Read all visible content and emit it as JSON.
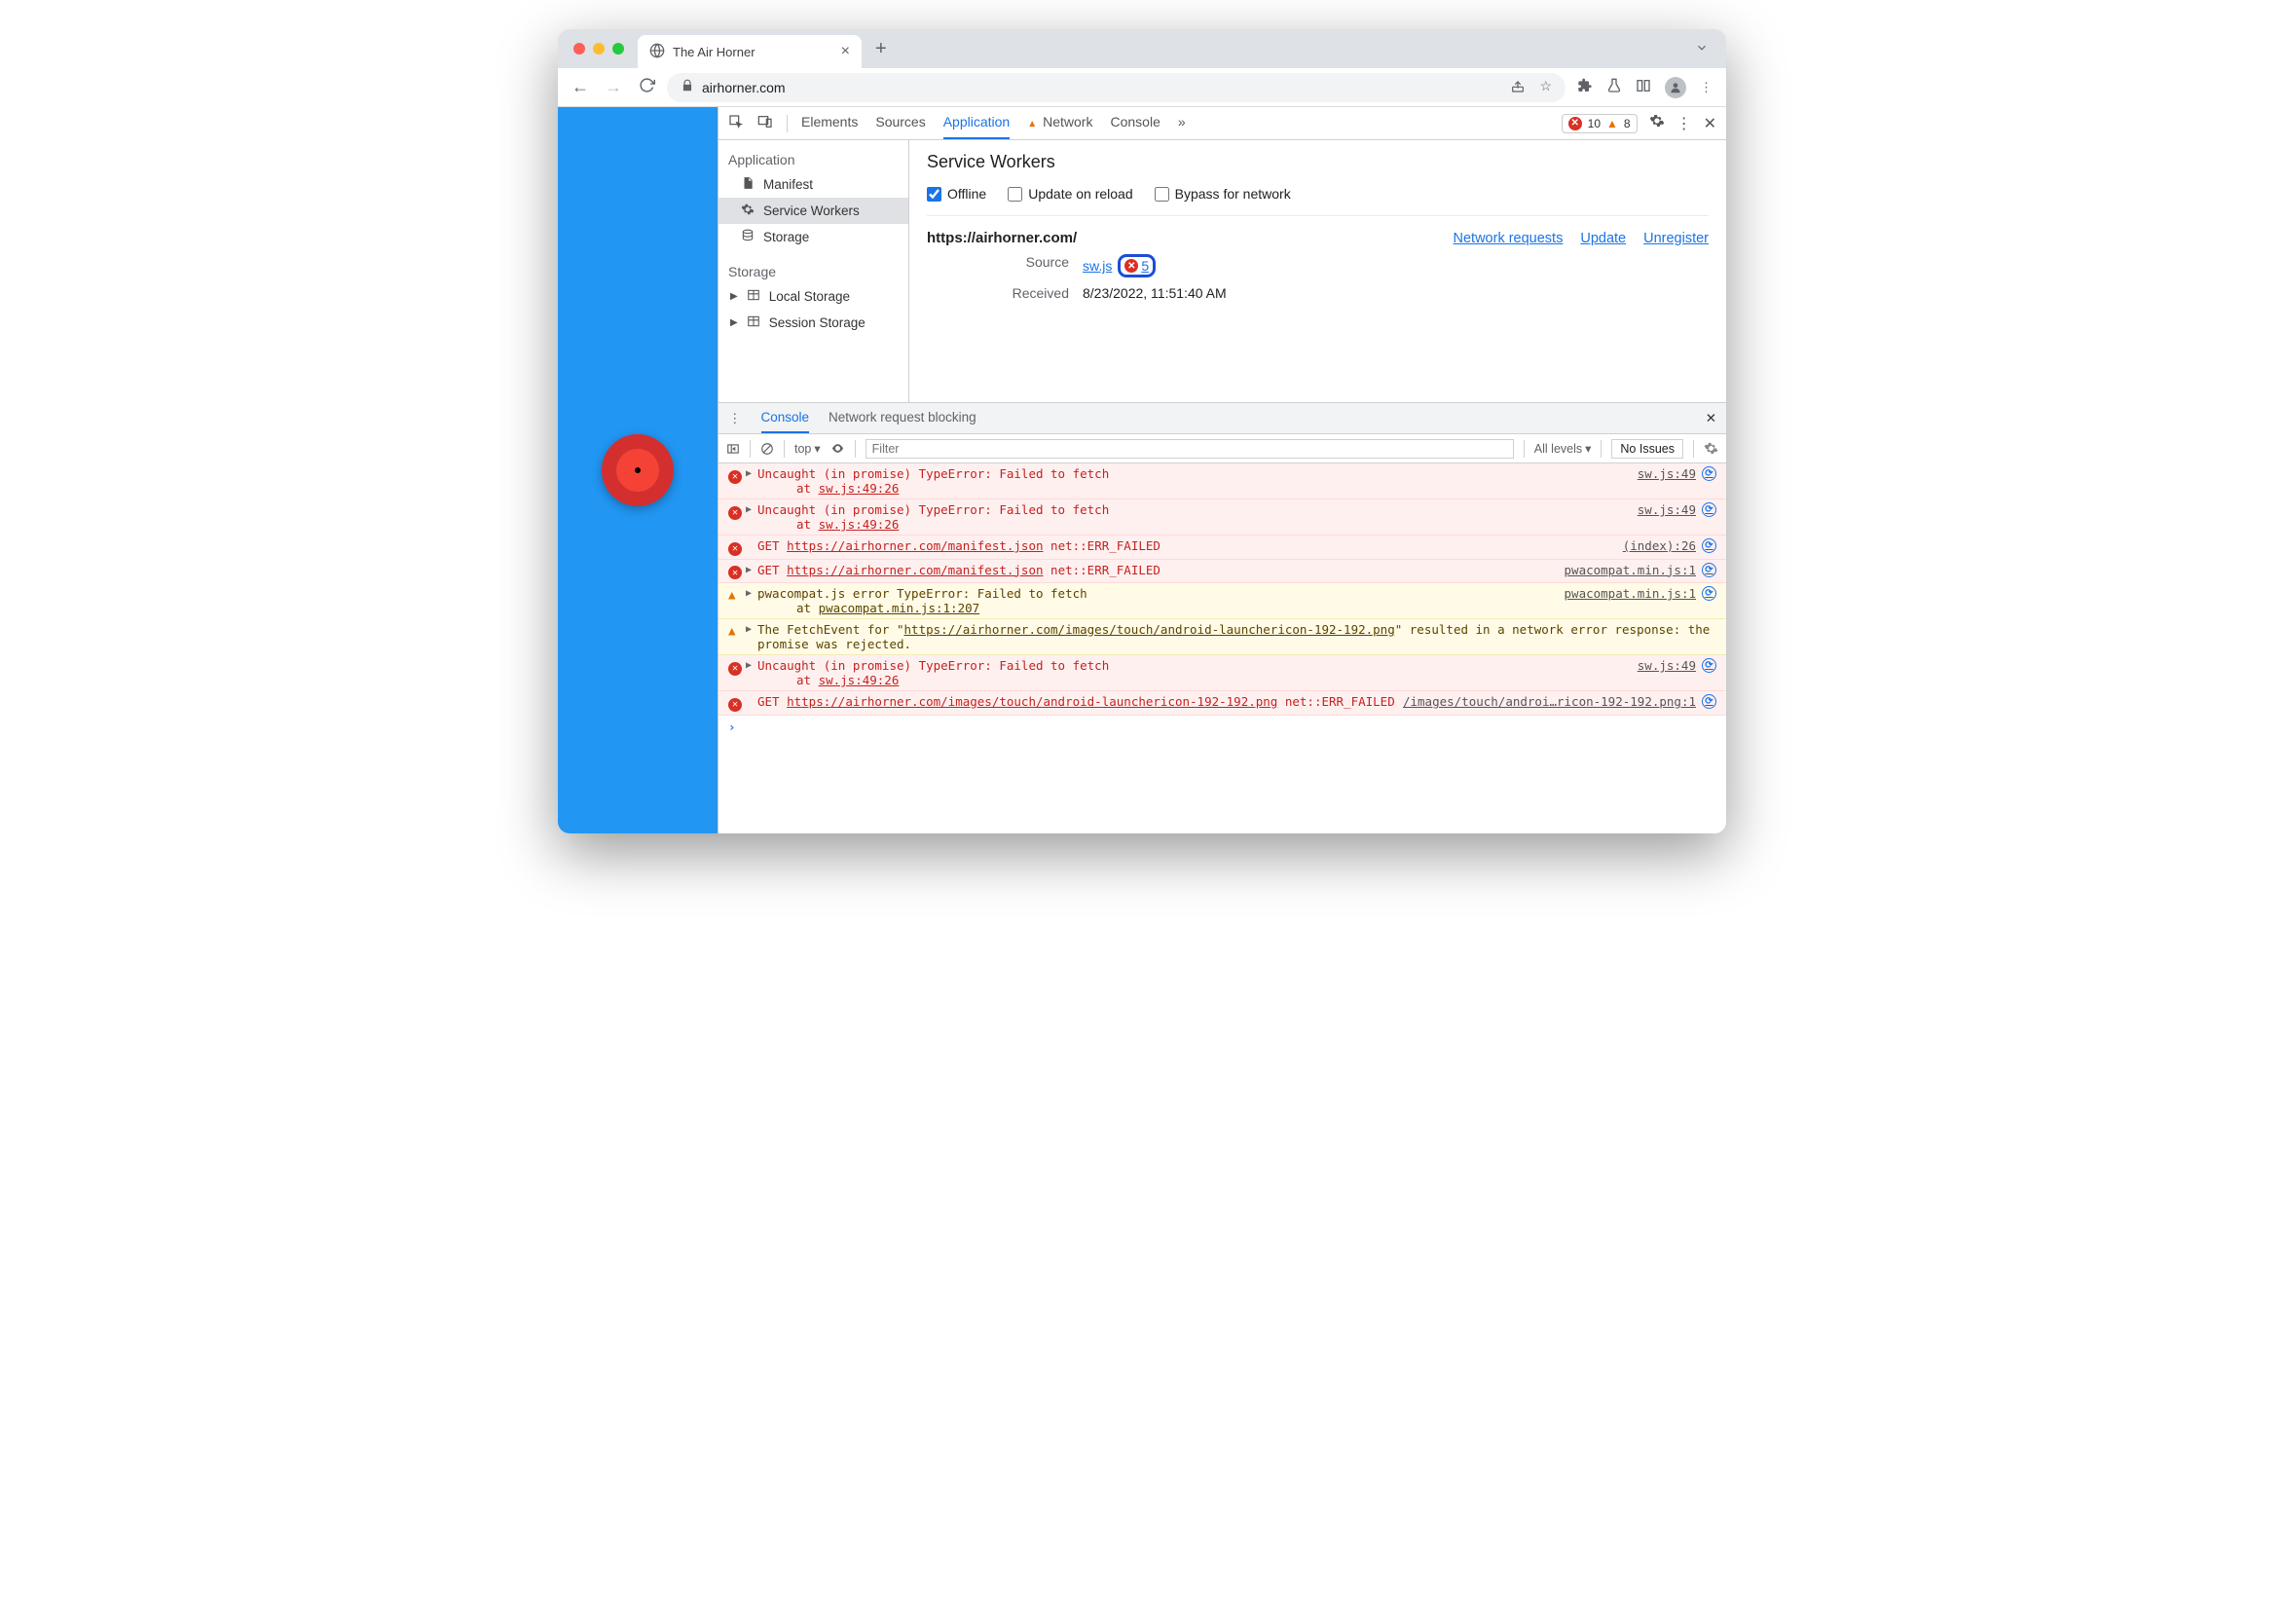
{
  "browser": {
    "tab_title": "The Air Horner",
    "url": "airhorner.com"
  },
  "devtools": {
    "tabs": {
      "elements": "Elements",
      "sources": "Sources",
      "application": "Application",
      "network": "Network",
      "console": "Console",
      "more": "»"
    },
    "error_count": "10",
    "warning_count": "8"
  },
  "app_sidebar": {
    "section_application": "Application",
    "manifest": "Manifest",
    "service_workers": "Service Workers",
    "storage": "Storage",
    "section_storage": "Storage",
    "local_storage": "Local Storage",
    "session_storage": "Session Storage"
  },
  "sw_panel": {
    "title": "Service Workers",
    "opt_offline": "Offline",
    "opt_update": "Update on reload",
    "opt_bypass": "Bypass for network",
    "origin": "https://airhorner.com/",
    "link_network": "Network requests",
    "link_update": "Update",
    "link_unregister": "Unregister",
    "label_source": "Source",
    "source_file": "sw.js",
    "error_count": "5",
    "label_received": "Received",
    "received_value": "8/23/2022, 11:51:40 AM"
  },
  "drawer": {
    "tab_console": "Console",
    "tab_blocking": "Network request blocking"
  },
  "console_toolbar": {
    "context": "top",
    "filter_placeholder": "Filter",
    "levels": "All levels",
    "issues": "No Issues"
  },
  "messages": [
    {
      "type": "err",
      "expandable": true,
      "body": "Uncaught (in promise) TypeError: Failed to fetch\n    at sw.js:49:26",
      "loc": "sw.js:49"
    },
    {
      "type": "err",
      "expandable": true,
      "body": "Uncaught (in promise) TypeError: Failed to fetch\n    at sw.js:49:26",
      "loc": "sw.js:49"
    },
    {
      "type": "err",
      "expandable": false,
      "body_html": "GET <span class='url'>https://airhorner.com/manifest.json</span> net::ERR_FAILED",
      "loc": "(index):26"
    },
    {
      "type": "err",
      "expandable": true,
      "body_html": "GET <span class='url'>https://airhorner.com/manifest.json</span> net::ERR_FAILED",
      "loc": "pwacompat.min.js:1"
    },
    {
      "type": "warn",
      "expandable": true,
      "body": "pwacompat.js error TypeError: Failed to fetch\n    at pwacompat.min.js:1:207",
      "loc": "pwacompat.min.js:1"
    },
    {
      "type": "warn",
      "expandable": true,
      "body_html": "The FetchEvent for \"<span class='url'>https://airhorner.com/images/touch/android-launchericon-192-192.png</span>\" resulted in a network error response: the promise was rejected.",
      "loc": ""
    },
    {
      "type": "err",
      "expandable": true,
      "body": "Uncaught (in promise) TypeError: Failed to fetch\n    at sw.js:49:26",
      "loc": "sw.js:49"
    },
    {
      "type": "err",
      "expandable": false,
      "body_html": "GET <span class='url'>https://airhorner.com/images/touch/android-launchericon-192-192.png</span> net::ERR_FAILED",
      "loc": "/images/touch/androi…ricon-192-192.png:1"
    }
  ]
}
